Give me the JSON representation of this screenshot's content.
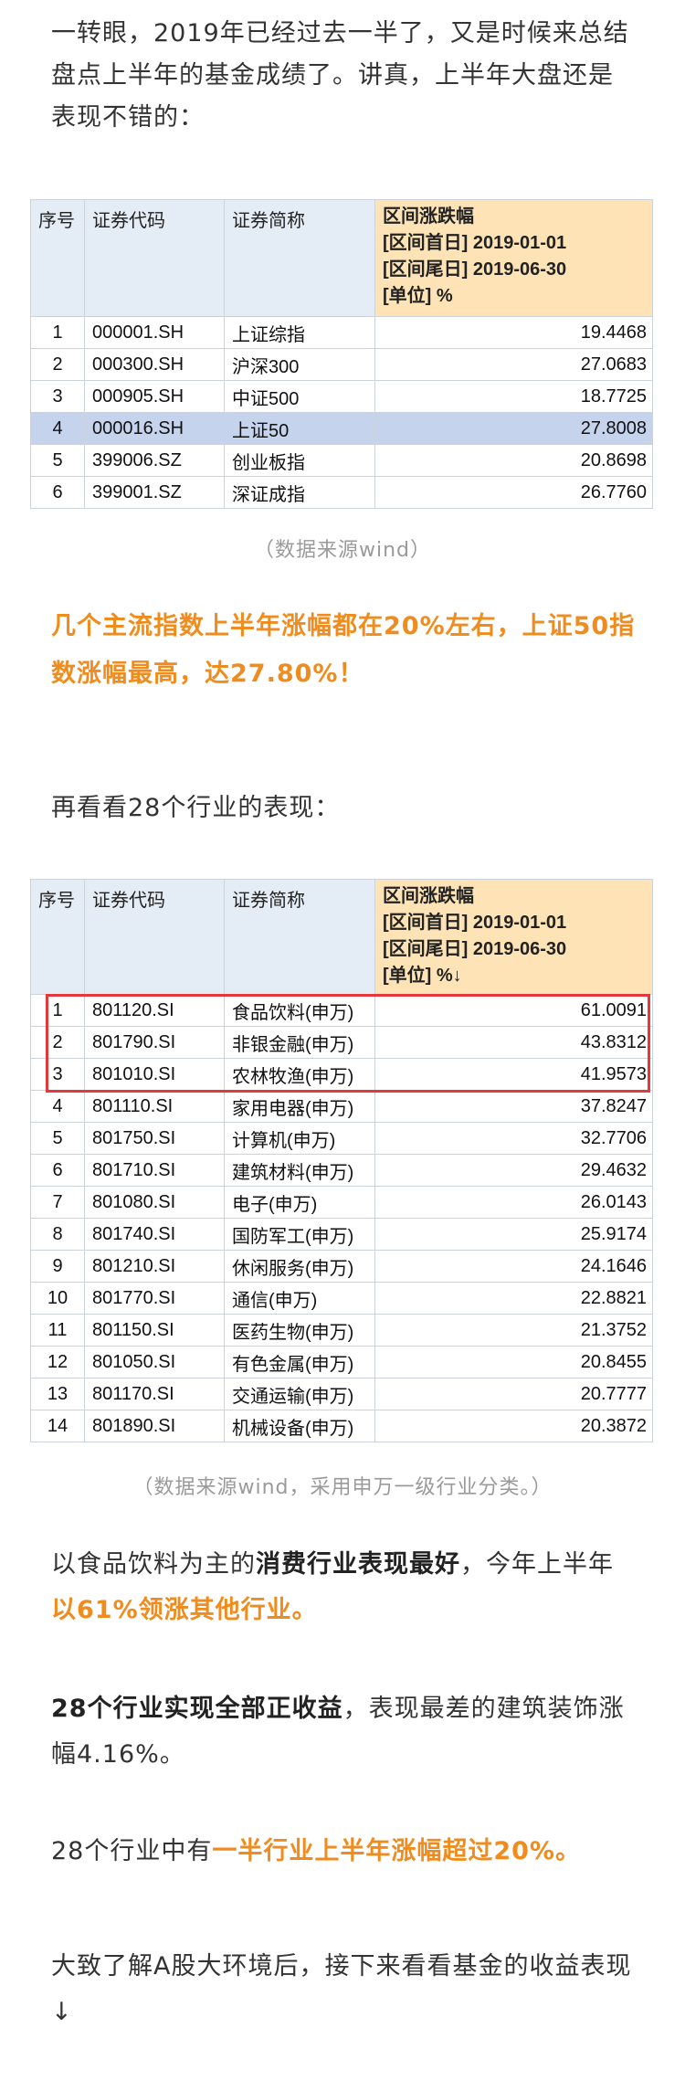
{
  "intro": {
    "text": "一转眼，2019年已经过去一半了，又是时候来总结盘点上半年的基金成绩了。讲真，上半年大盘还是表现不错的："
  },
  "table1": {
    "headers": {
      "seq": "序号",
      "code": "证券代码",
      "name": "证券简称",
      "change": [
        "区间涨跌幅",
        "[区间首日] 2019-01-01",
        "[区间尾日] 2019-06-30",
        "[单位] %"
      ]
    },
    "rows": [
      {
        "seq": "1",
        "code": "000001.SH",
        "name": "上证综指",
        "value": "19.4468"
      },
      {
        "seq": "2",
        "code": "000300.SH",
        "name": "沪深300",
        "value": "27.0683"
      },
      {
        "seq": "3",
        "code": "000905.SH",
        "name": "中证500",
        "value": "18.7725"
      },
      {
        "seq": "4",
        "code": "000016.SH",
        "name": "上证50",
        "value": "27.8008"
      },
      {
        "seq": "5",
        "code": "399006.SZ",
        "name": "创业板指",
        "value": "20.8698"
      },
      {
        "seq": "6",
        "code": "399001.SZ",
        "name": "深证成指",
        "value": "26.7760"
      }
    ],
    "caption": "（数据来源wind）"
  },
  "highlight1": {
    "text": "几个主流指数上半年涨幅都在20%左右，上证50指数涨幅最高，达27.80%！"
  },
  "para2": {
    "text": "再看看28个行业的表现："
  },
  "table2": {
    "headers": {
      "seq": "序号",
      "code": "证券代码",
      "name": "证券简称",
      "change": [
        "区间涨跌幅",
        "[区间首日] 2019-01-01",
        "[区间尾日] 2019-06-30",
        "[单位] %↓"
      ]
    },
    "rows": [
      {
        "seq": "1",
        "code": "801120.SI",
        "name": "食品饮料(申万)",
        "value": "61.0091"
      },
      {
        "seq": "2",
        "code": "801790.SI",
        "name": "非银金融(申万)",
        "value": "43.8312"
      },
      {
        "seq": "3",
        "code": "801010.SI",
        "name": "农林牧渔(申万)",
        "value": "41.9573"
      },
      {
        "seq": "4",
        "code": "801110.SI",
        "name": "家用电器(申万)",
        "value": "37.8247"
      },
      {
        "seq": "5",
        "code": "801750.SI",
        "name": "计算机(申万)",
        "value": "32.7706"
      },
      {
        "seq": "6",
        "code": "801710.SI",
        "name": "建筑材料(申万)",
        "value": "29.4632"
      },
      {
        "seq": "7",
        "code": "801080.SI",
        "name": "电子(申万)",
        "value": "26.0143"
      },
      {
        "seq": "8",
        "code": "801740.SI",
        "name": "国防军工(申万)",
        "value": "25.9174"
      },
      {
        "seq": "9",
        "code": "801210.SI",
        "name": "休闲服务(申万)",
        "value": "24.1646"
      },
      {
        "seq": "10",
        "code": "801770.SI",
        "name": "通信(申万)",
        "value": "22.8821"
      },
      {
        "seq": "11",
        "code": "801150.SI",
        "name": "医药生物(申万)",
        "value": "21.3752"
      },
      {
        "seq": "12",
        "code": "801050.SI",
        "name": "有色金属(申万)",
        "value": "20.8455"
      },
      {
        "seq": "13",
        "code": "801170.SI",
        "name": "交通运输(申万)",
        "value": "20.7777"
      },
      {
        "seq": "14",
        "code": "801890.SI",
        "name": "机械设备(申万)",
        "value": "20.3872"
      }
    ],
    "caption": "（数据来源wind，采用申万一级行业分类。）"
  },
  "para3": {
    "a": "以食品饮料为主的",
    "b": "消费行业表现最好",
    "c": "，今年上半年",
    "d": "以61%领涨其他行业。"
  },
  "para4": {
    "a": "28个行业实现全部正收益",
    "b": "，表现最差的建筑装饰涨幅4.16%。"
  },
  "para5": {
    "a": "28个行业中有",
    "b": "一半行业上半年涨幅超过20%。"
  },
  "para6": {
    "text": "大致了解A股大环境后，接下来看看基金的收益表现↓"
  }
}
